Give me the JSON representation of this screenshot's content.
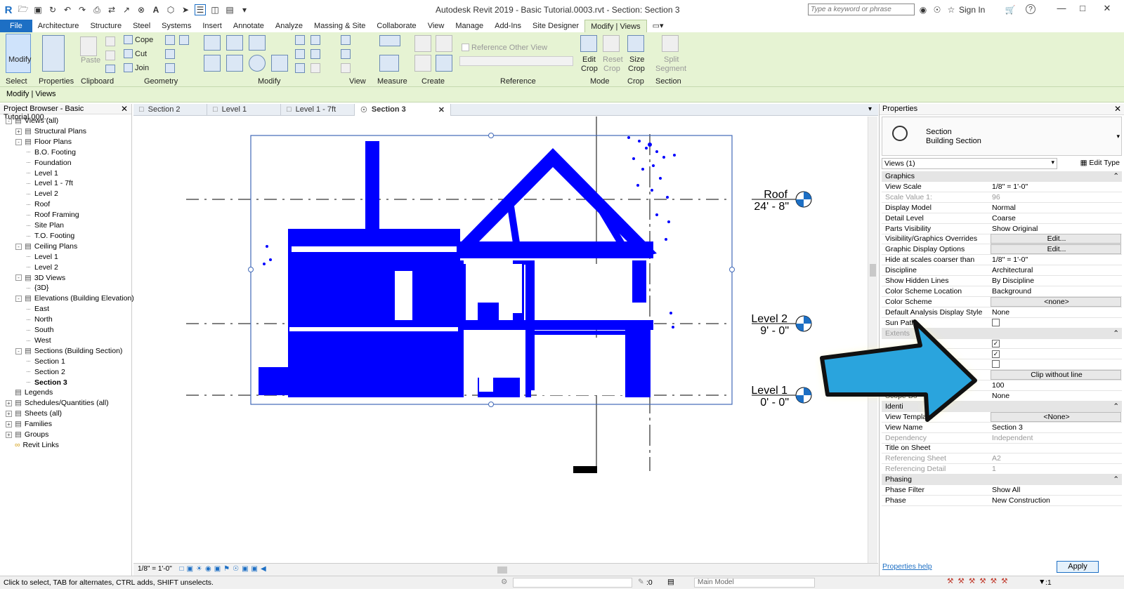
{
  "app": {
    "title": "Autodesk Revit 2019 - Basic Tutorial.0003.rvt - Section: Section 3",
    "search_placeholder": "Type a keyword or phrase",
    "sign_in": "Sign In",
    "help": "?"
  },
  "menu_tabs": [
    "File",
    "Architecture",
    "Structure",
    "Steel",
    "Systems",
    "Insert",
    "Annotate",
    "Analyze",
    "Massing & Site",
    "Collaborate",
    "View",
    "Manage",
    "Add-Ins",
    "Site Designer",
    "Modify | Views"
  ],
  "ribbon": {
    "panels": {
      "select": "Select",
      "properties": "Properties",
      "clipboard": "Clipboard",
      "geometry": "Geometry",
      "modify": "Modify",
      "view": "View",
      "measure": "Measure",
      "create": "Create",
      "reference": "Reference",
      "mode": "Mode",
      "crop": "Crop",
      "section": "Section"
    },
    "modify_btn": "Modify",
    "paste_btn": "Paste",
    "cope": "Cope",
    "cut": "Cut",
    "join": "Join",
    "reference_other_view": "Reference Other View",
    "edit_crop": [
      "Edit",
      "Crop"
    ],
    "reset_crop": [
      "Reset",
      "Crop"
    ],
    "size_crop": [
      "Size",
      "Crop"
    ],
    "split_segment": [
      "Split",
      "Segment"
    ]
  },
  "context_label": "Modify | Views",
  "browser": {
    "title": "Project Browser - Basic Tutorial.000...",
    "items": [
      {
        "label": "Views (all)",
        "level": 0,
        "toggle": "-"
      },
      {
        "label": "Structural Plans",
        "level": 1,
        "toggle": "+"
      },
      {
        "label": "Floor Plans",
        "level": 1,
        "toggle": "-"
      },
      {
        "label": "B.O. Footing",
        "level": 2
      },
      {
        "label": "Foundation",
        "level": 2
      },
      {
        "label": "Level 1",
        "level": 2
      },
      {
        "label": "Level 1 - 7ft",
        "level": 2
      },
      {
        "label": "Level 2",
        "level": 2
      },
      {
        "label": "Roof",
        "level": 2
      },
      {
        "label": "Roof Framing",
        "level": 2
      },
      {
        "label": "Site Plan",
        "level": 2
      },
      {
        "label": "T.O. Footing",
        "level": 2
      },
      {
        "label": "Ceiling Plans",
        "level": 1,
        "toggle": "-"
      },
      {
        "label": "Level 1",
        "level": 2
      },
      {
        "label": "Level 2",
        "level": 2
      },
      {
        "label": "3D Views",
        "level": 1,
        "toggle": "-"
      },
      {
        "label": "{3D}",
        "level": 2
      },
      {
        "label": "Elevations (Building Elevation)",
        "level": 1,
        "toggle": "-"
      },
      {
        "label": "East",
        "level": 2
      },
      {
        "label": "North",
        "level": 2
      },
      {
        "label": "South",
        "level": 2
      },
      {
        "label": "West",
        "level": 2
      },
      {
        "label": "Sections (Building Section)",
        "level": 1,
        "toggle": "-"
      },
      {
        "label": "Section 1",
        "level": 2
      },
      {
        "label": "Section 2",
        "level": 2
      },
      {
        "label": "Section 3",
        "level": 2,
        "bold": true
      },
      {
        "label": "Legends",
        "level": 0
      },
      {
        "label": "Schedules/Quantities (all)",
        "level": 0,
        "toggle": "+"
      },
      {
        "label": "Sheets (all)",
        "level": 0,
        "toggle": "+"
      },
      {
        "label": "Families",
        "level": 0,
        "toggle": "+"
      },
      {
        "label": "Groups",
        "level": 0,
        "toggle": "+"
      },
      {
        "label": "Revit Links",
        "level": 0
      }
    ]
  },
  "view_tabs": [
    {
      "label": "Section 2"
    },
    {
      "label": "Level 1"
    },
    {
      "label": "Level 1 - 7ft"
    },
    {
      "label": "Section 3",
      "active": true
    }
  ],
  "levels": [
    {
      "name": "Roof",
      "elev": "24' - 8\""
    },
    {
      "name": "Level 2",
      "elev": "9' - 0\""
    },
    {
      "name": "Level 1",
      "elev": "0' - 0\""
    }
  ],
  "view_scale_short": "1/8\" = 1'-0\"",
  "properties": {
    "title": "Properties",
    "type_name": "Section",
    "type_sub": "Building Section",
    "instance_selector": "Views (1)",
    "edit_type": "Edit Type",
    "rows": [
      {
        "kind": "header",
        "name": "Graphics"
      },
      {
        "name": "View Scale",
        "value": "1/8\" = 1'-0\""
      },
      {
        "name": "Scale Value    1:",
        "value": "96",
        "disabled": true
      },
      {
        "name": "Display Model",
        "value": "Normal"
      },
      {
        "name": "Detail Level",
        "value": "Coarse"
      },
      {
        "name": "Parts Visibility",
        "value": "Show Original"
      },
      {
        "name": "Visibility/Graphics Overrides",
        "value": "Edit...",
        "button": true
      },
      {
        "name": "Graphic Display Options",
        "value": "Edit...",
        "button": true
      },
      {
        "name": "Hide at scales coarser than",
        "value": "1/8\" = 1'-0\""
      },
      {
        "name": "Discipline",
        "value": "Architectural"
      },
      {
        "name": "Show Hidden Lines",
        "value": "By Discipline"
      },
      {
        "name": "Color Scheme Location",
        "value": "Background"
      },
      {
        "name": "Color Scheme",
        "value": "<none>",
        "button": true
      },
      {
        "name": "Default Analysis Display Style",
        "value": "None"
      },
      {
        "name": "Sun Path",
        "value": "",
        "checkbox": false
      },
      {
        "kind": "header",
        "name": "Extents",
        "disabled": true
      },
      {
        "name": "",
        "value": "",
        "checkbox": true
      },
      {
        "name": "",
        "value": "",
        "checkbox": true
      },
      {
        "name": "",
        "value": "",
        "checkbox": false
      },
      {
        "name": "",
        "value": "Clip without line",
        "button": true
      },
      {
        "name": "Far Clip Of",
        "value": "100",
        "disabled_name": true
      },
      {
        "name": "Scope Bo",
        "value": "None"
      },
      {
        "kind": "header",
        "name": "Identi"
      },
      {
        "name": "View Template",
        "value": "<None>",
        "button": true
      },
      {
        "name": "View Name",
        "value": "Section 3"
      },
      {
        "name": "Dependency",
        "value": "Independent",
        "disabled": true
      },
      {
        "name": "Title on Sheet",
        "value": ""
      },
      {
        "name": "Referencing Sheet",
        "value": "A2",
        "disabled": true
      },
      {
        "name": "Referencing Detail",
        "value": "1",
        "disabled": true
      },
      {
        "kind": "header",
        "name": "Phasing"
      },
      {
        "name": "Phase Filter",
        "value": "Show All"
      },
      {
        "name": "Phase",
        "value": "New Construction"
      }
    ],
    "help_link": "Properties help",
    "apply": "Apply"
  },
  "status": {
    "hint": "Click to select, TAB for alternates, CTRL adds, SHIFT unselects.",
    "zero": ":0",
    "model": "Main Model",
    "filter": ":1"
  },
  "colors": {
    "accent": "#1d6fc4",
    "point_cloud": "#0000ff",
    "arrow": "#2aa4dd",
    "ribbon_bg": "#e6f3d3"
  }
}
